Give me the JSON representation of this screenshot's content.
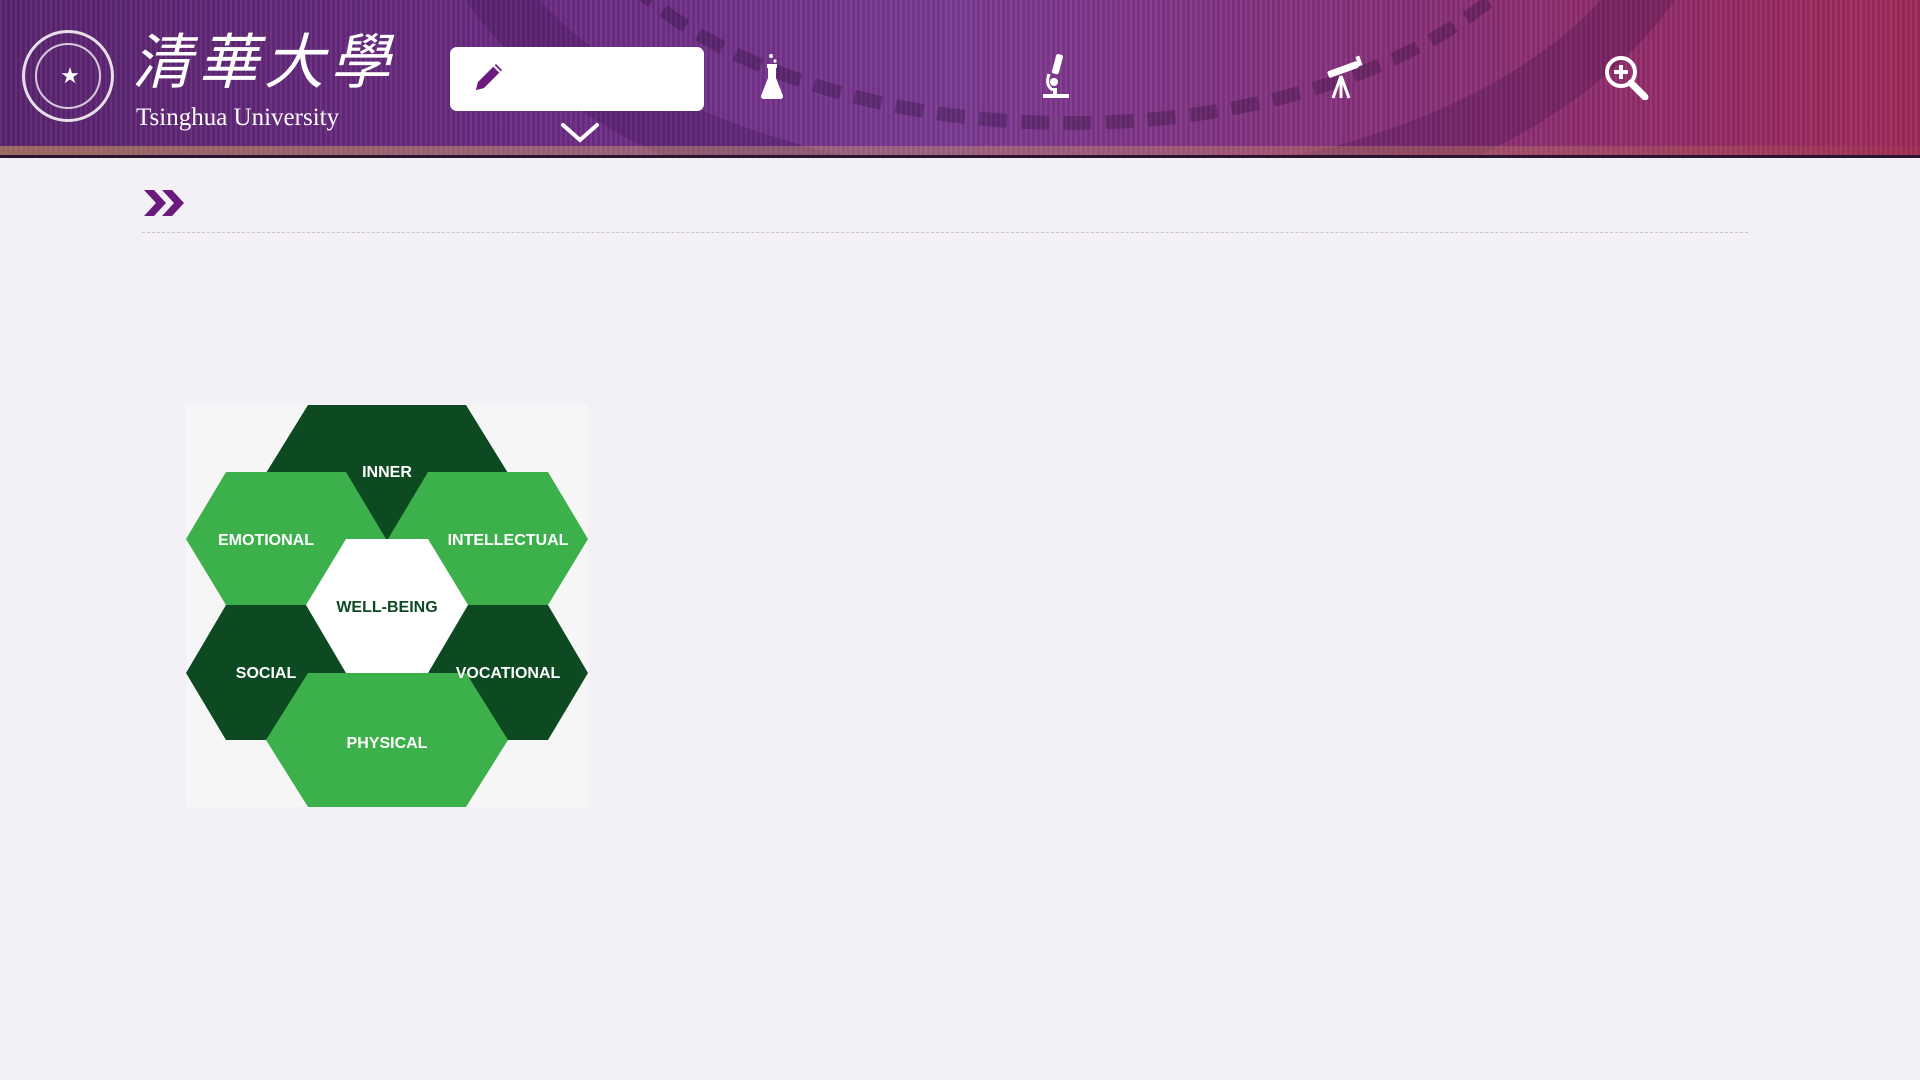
{
  "header": {
    "logo": {
      "name_cn": "清華大學",
      "name_en": "Tsinghua University"
    },
    "nav": [
      {
        "icon": "pencil-icon",
        "label": "",
        "active": true
      },
      {
        "icon": "flask-icon",
        "label": "",
        "active": false
      },
      {
        "icon": "microscope-icon",
        "label": "",
        "active": false
      },
      {
        "icon": "telescope-icon",
        "label": "",
        "active": false
      },
      {
        "icon": "zoom-in-icon",
        "label": "",
        "active": false
      }
    ],
    "dropdown_icon": "chevron-down-icon"
  },
  "section": {
    "icon": "double-chevron-right-icon",
    "title": ""
  },
  "figure": {
    "center": "WELL-BEING",
    "segments": [
      "INNER",
      "INTELLECTUAL",
      "VOCATIONAL",
      "PHYSICAL",
      "SOCIAL",
      "EMOTIONAL"
    ]
  },
  "colors": {
    "brand_purple": "#6a1a7c",
    "header_start": "#5a2470",
    "header_end": "#a02a5a",
    "page_background": "#f3f1f6",
    "hex_dark_green": "#0d4a22",
    "hex_light_green": "#3cb04a"
  }
}
